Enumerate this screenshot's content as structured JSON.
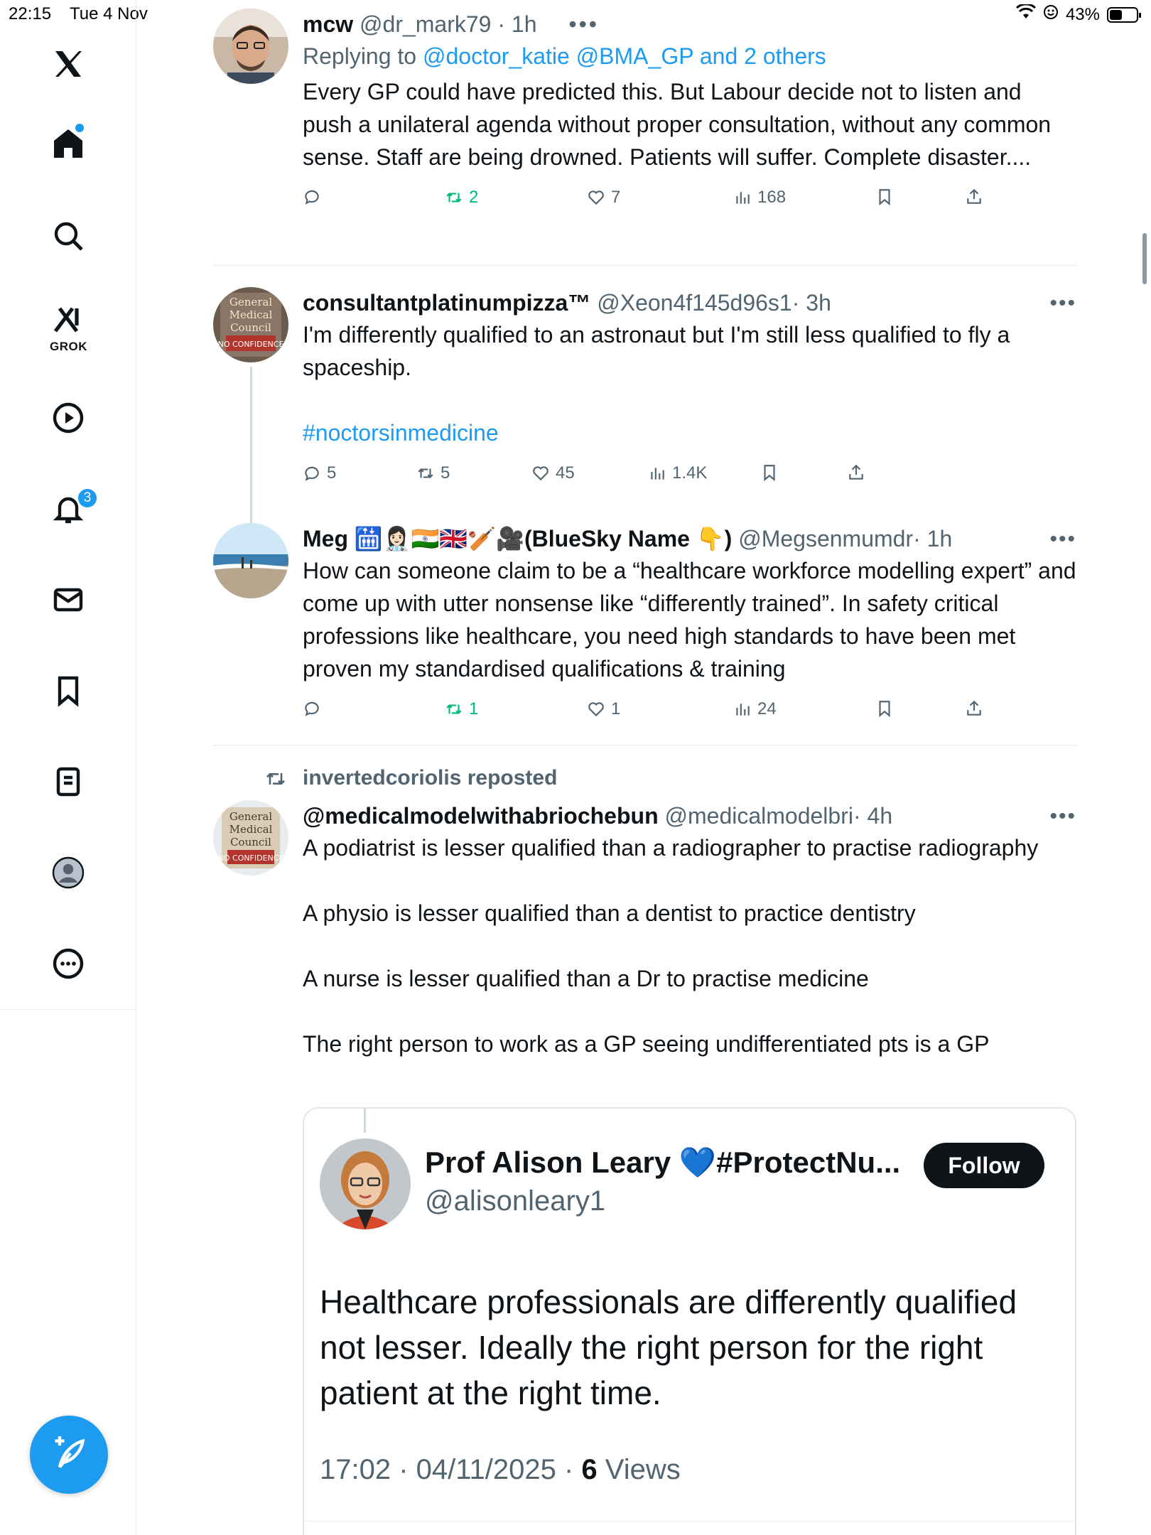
{
  "status_bar": {
    "time": "22:15",
    "date": "Tue 4 Nov",
    "battery": "43%",
    "battery_level": 0.43
  },
  "sidebar": {
    "grok_label": "GROK",
    "notifications_badge": "3",
    "icons": [
      "x-logo-icon",
      "home-icon",
      "search-icon",
      "grok-icon",
      "video-icon",
      "bell-icon",
      "mail-icon",
      "bookmark-icon",
      "lists-icon",
      "profile-icon",
      "more-icon",
      "compose-icon"
    ]
  },
  "tweets": [
    {
      "name": "mcw",
      "handle": "@dr_mark79",
      "time": "· 1h",
      "replying_prefix": "Replying to ",
      "replying_to": "@doctor_katie @BMA_GP and 2 others",
      "text": "Every GP could have predicted this. But Labour decide not to listen and push a unilateral agenda without proper consultation, without any common sense. Staff are being drowned. Patients will suffer. Complete disaster....",
      "replies": "",
      "reposts": "2",
      "likes": "7",
      "views": "168"
    },
    {
      "name": "consultantplatinumpizza™",
      "handle": "@Xeon4f145d96s1",
      "time": "· 3h",
      "text": "I'm differently qualified to an astronaut but I'm still less qualified to fly a spaceship.",
      "hashtag": "#noctorsinmedicine",
      "replies": "5",
      "reposts": "5",
      "likes": "45",
      "views": "1.4K"
    },
    {
      "name": "Meg 🛗👩🏻‍⚕️🇮🇳🇬🇧🏏🎥(BlueSky Name 👇)",
      "handle": "@Megsenmumdr",
      "time": "· 1h",
      "text": "How can someone claim to be a “healthcare workforce modelling expert” and come up with utter nonsense like “differently trained”. In safety critical professions like healthcare, you need high standards to have been met proven my standardised qualifications & training",
      "replies": "",
      "reposts": "1",
      "likes": "1",
      "views": "24"
    },
    {
      "repost_label": "invertedcoriolis reposted",
      "name": "@medicalmodelwithabriochebun",
      "handle": "@medicalmodelbri",
      "time": "· 4h",
      "text": "A podiatrist is lesser qualified than a radiographer to practise radiography\n\nA physio is lesser qualified than a dentist to practice dentistry\n\nA nurse is lesser qualified than a Dr to practise medicine\n\nThe right person to work as a GP seeing undifferentiated pts is a GP",
      "quote": {
        "name": "Prof Alison Leary 💙#ProtectNu...",
        "handle": "@alisonleary1",
        "follow": "Follow",
        "text": "Healthcare professionals are differently qualified not lesser.  Ideally the right person for the right patient at the right time.",
        "meta_time": "17:02 · 04/11/2025 · ",
        "views_count": "6",
        "views_label": " Views"
      }
    }
  ],
  "colors": {
    "accent": "#1d9bf0",
    "repost_green": "#00ba7c",
    "secondary_text": "#536471"
  }
}
